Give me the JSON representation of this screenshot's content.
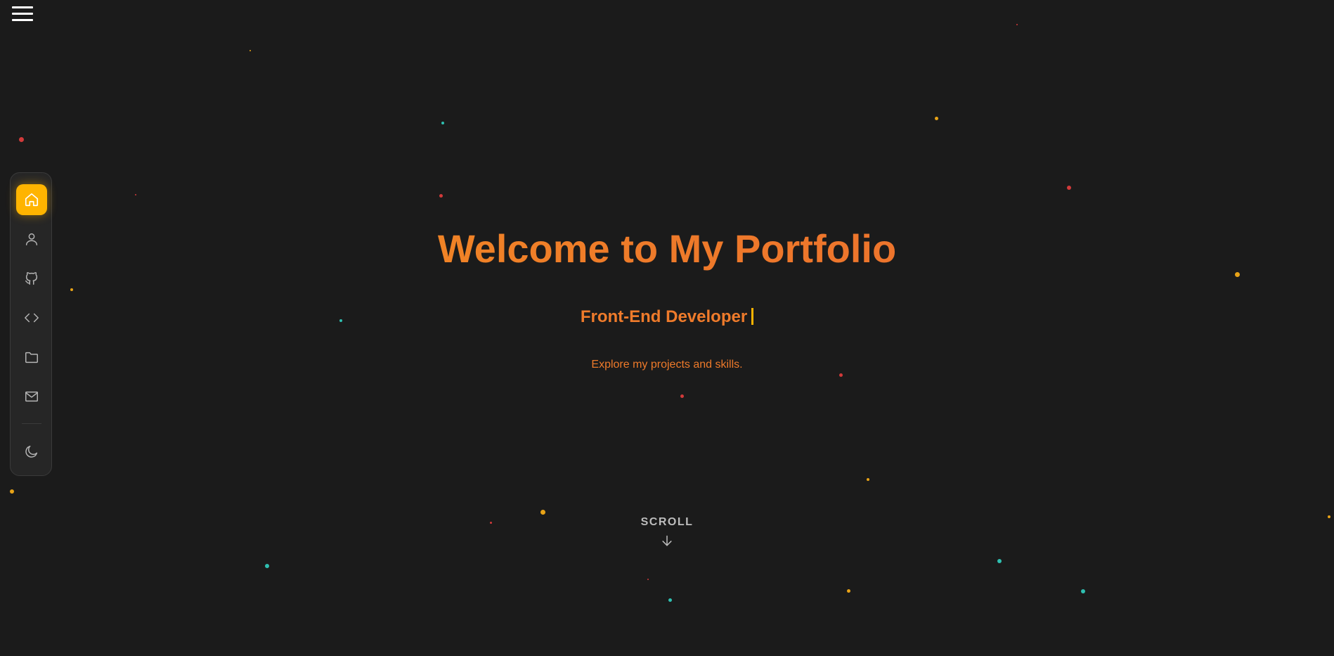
{
  "hero": {
    "title": "Welcome to My Portfolio",
    "subtitle": "Front-End Developer",
    "tagline": "Explore my projects and skills."
  },
  "scroll": {
    "label": "SCROLL",
    "icon": "arrow-down-icon"
  },
  "header": {
    "menu_icon": "hamburger-menu-icon"
  },
  "sidebar": {
    "items": [
      {
        "id": "home",
        "icon": "home-icon",
        "active": true
      },
      {
        "id": "about",
        "icon": "user-icon",
        "active": false
      },
      {
        "id": "github",
        "icon": "github-icon",
        "active": false
      },
      {
        "id": "skills",
        "icon": "code-icon",
        "active": false
      },
      {
        "id": "projects",
        "icon": "folder-icon",
        "active": false
      },
      {
        "id": "contact",
        "icon": "mail-icon",
        "active": false
      }
    ],
    "theme_toggle_icon": "moon-icon"
  },
  "colors": {
    "background": "#1b1b1b",
    "accent": "#ffb400",
    "title_gradient_start": "#f4941f",
    "title_gradient_end": "#eb6a30",
    "particle_red": "#d23a3a",
    "particle_teal": "#2fbfb0",
    "particle_yellow": "#e8a317"
  }
}
